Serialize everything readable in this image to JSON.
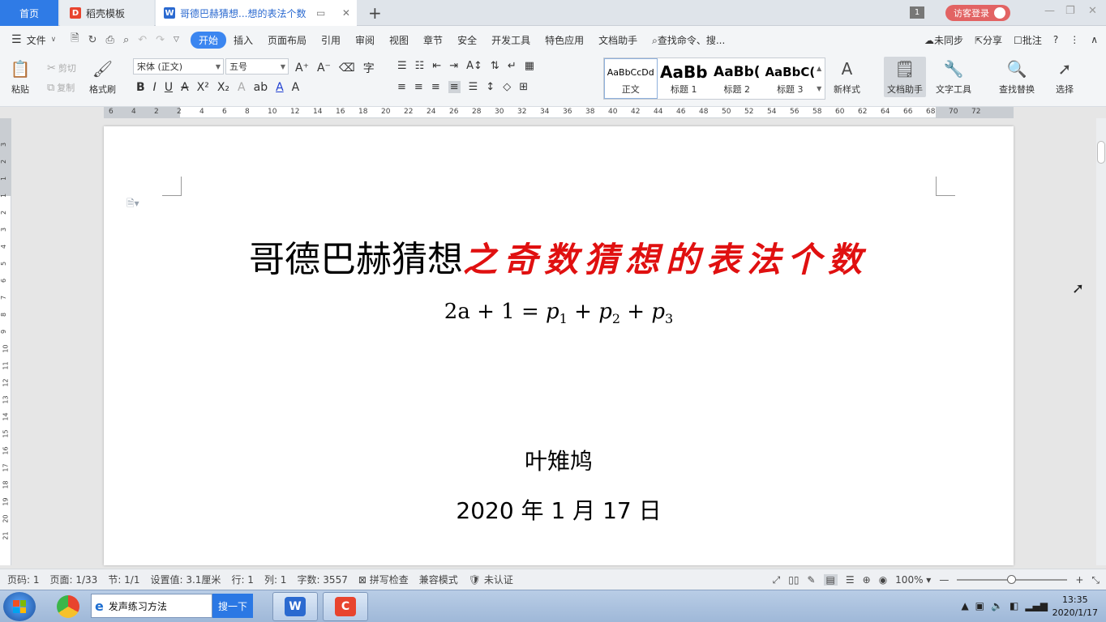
{
  "tabs": {
    "home": "首页",
    "docer": "稻壳模板",
    "doc": "哥德巴赫猜想...想的表法个数"
  },
  "window": {
    "badge": "1",
    "login": "访客登录"
  },
  "menu": {
    "file": "文件",
    "items": [
      "开始",
      "插入",
      "页面布局",
      "引用",
      "审阅",
      "视图",
      "章节",
      "安全",
      "开发工具",
      "特色应用",
      "文档助手"
    ],
    "search": "查找命令、搜...",
    "sync": "未同步",
    "share": "分享",
    "comment": "批注"
  },
  "ribbon": {
    "paste": "粘贴",
    "cut": "剪切",
    "copy": "复制",
    "format_painter": "格式刷",
    "font_name": "宋体 (正文)",
    "font_size": "五号",
    "styles": [
      {
        "preview": "AaBbCcDd",
        "name": "正文"
      },
      {
        "preview": "AaBb",
        "name": "标题 1"
      },
      {
        "preview": "AaBb(",
        "name": "标题 2"
      },
      {
        "preview": "AaBbC(",
        "name": "标题 3"
      }
    ],
    "new_style": "新样式",
    "doc_assistant": "文档助手",
    "text_tools": "文字工具",
    "find_replace": "查找替换",
    "select": "选择"
  },
  "ruler": {
    "h_ticks": [
      "6",
      "4",
      "2",
      "2",
      "4",
      "6",
      "8",
      "10",
      "12",
      "14",
      "16",
      "18",
      "20",
      "22",
      "24",
      "26",
      "28",
      "30",
      "32",
      "34",
      "36",
      "38",
      "40",
      "42",
      "44",
      "46",
      "48",
      "50",
      "52",
      "54",
      "56",
      "58",
      "60",
      "62",
      "64",
      "66",
      "68",
      "70",
      "72"
    ],
    "v_ticks": [
      "3",
      "2",
      "1",
      "1",
      "2",
      "3",
      "4",
      "5",
      "6",
      "7",
      "8",
      "9",
      "10",
      "11",
      "12",
      "13",
      "14",
      "15",
      "16",
      "17",
      "18",
      "19",
      "20",
      "21"
    ]
  },
  "document": {
    "title_plain": "哥德巴赫猜想",
    "title_red": "之奇数猜想的表法个数",
    "formula": {
      "lhs": "2a + 1 = ",
      "p": "p",
      "sub1": "1",
      "sub2": "2",
      "sub3": "3",
      "plus": " + "
    },
    "author": "叶雉鸠",
    "date": "2020 年 1 月 17 日"
  },
  "status": {
    "page_num": "页码: 1",
    "pages": "页面: 1/33",
    "section": "节: 1/1",
    "setting": "设置值: 3.1厘米",
    "row": "行: 1",
    "col": "列: 1",
    "words": "字数: 3557",
    "spell": "拼写检查",
    "compat": "兼容模式",
    "cert": "未认证",
    "zoom": "100%"
  },
  "taskbar": {
    "browser_text": "发声练习方法",
    "search_btn": "搜一下",
    "time": "13:35",
    "date": "2020/1/17"
  }
}
